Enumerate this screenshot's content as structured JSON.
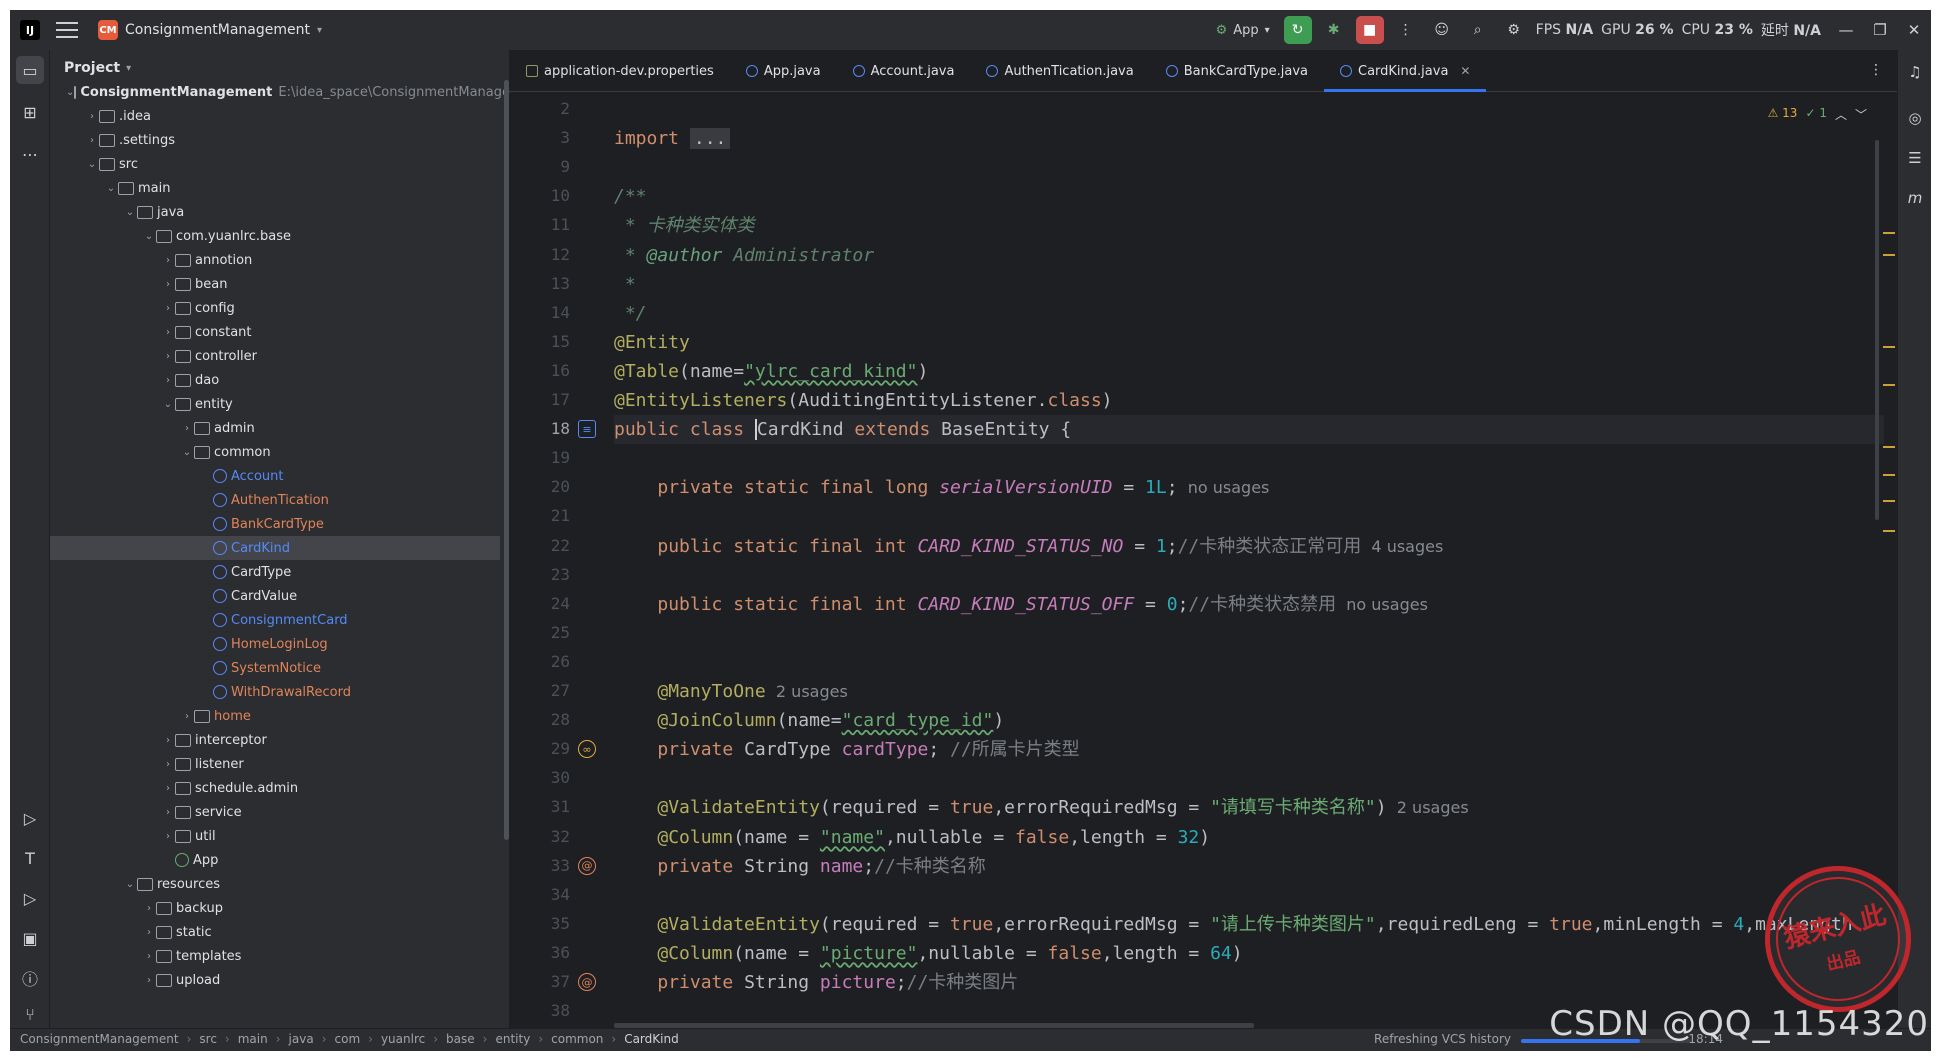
{
  "titlebar": {
    "project_badge": "CM",
    "project_name": "ConsignmentManagement",
    "run_config": "App",
    "stats": {
      "fps_label": "FPS",
      "fps_value": "N/A",
      "gpu_label": "GPU",
      "gpu_value": "26 %",
      "cpu_label": "CPU",
      "cpu_value": "23 %",
      "latency_label": "延时",
      "latency_value": "N/A"
    }
  },
  "project_panel": {
    "title": "Project",
    "tree": [
      {
        "label": "ConsignmentManagement",
        "path": "E:\\idea_space\\ConsignmentManagement",
        "depth": 0,
        "kind": "root",
        "open": true
      },
      {
        "label": ".idea",
        "depth": 1,
        "kind": "dir",
        "open": false
      },
      {
        "label": ".settings",
        "depth": 1,
        "kind": "dir",
        "open": false
      },
      {
        "label": "src",
        "depth": 1,
        "kind": "dir",
        "open": true
      },
      {
        "label": "main",
        "depth": 2,
        "kind": "dir",
        "open": true
      },
      {
        "label": "java",
        "depth": 3,
        "kind": "dir",
        "open": true
      },
      {
        "label": "com.yuanlrc.base",
        "depth": 4,
        "kind": "dir",
        "open": true
      },
      {
        "label": "annotion",
        "depth": 5,
        "kind": "dir",
        "open": false
      },
      {
        "label": "bean",
        "depth": 5,
        "kind": "dir",
        "open": false
      },
      {
        "label": "config",
        "depth": 5,
        "kind": "dir",
        "open": false
      },
      {
        "label": "constant",
        "depth": 5,
        "kind": "dir",
        "open": false
      },
      {
        "label": "controller",
        "depth": 5,
        "kind": "dir",
        "open": false
      },
      {
        "label": "dao",
        "depth": 5,
        "kind": "dir",
        "open": false
      },
      {
        "label": "entity",
        "depth": 5,
        "kind": "dir",
        "open": true
      },
      {
        "label": "admin",
        "depth": 6,
        "kind": "dir",
        "open": false
      },
      {
        "label": "common",
        "depth": 6,
        "kind": "dir",
        "open": true
      },
      {
        "label": "Account",
        "depth": 7,
        "kind": "cls"
      },
      {
        "label": "AuthenTication",
        "depth": 7,
        "kind": "err"
      },
      {
        "label": "BankCardType",
        "depth": 7,
        "kind": "err"
      },
      {
        "label": "CardKind",
        "depth": 7,
        "kind": "cls",
        "selected": true
      },
      {
        "label": "CardType",
        "depth": 7,
        "kind": "plain"
      },
      {
        "label": "CardValue",
        "depth": 7,
        "kind": "plain"
      },
      {
        "label": "ConsignmentCard",
        "depth": 7,
        "kind": "cls"
      },
      {
        "label": "HomeLoginLog",
        "depth": 7,
        "kind": "err"
      },
      {
        "label": "SystemNotice",
        "depth": 7,
        "kind": "err"
      },
      {
        "label": "WithDrawalRecord",
        "depth": 7,
        "kind": "err"
      },
      {
        "label": "home",
        "depth": 6,
        "kind": "direrr",
        "open": false
      },
      {
        "label": "interceptor",
        "depth": 5,
        "kind": "dir",
        "open": false
      },
      {
        "label": "listener",
        "depth": 5,
        "kind": "dir",
        "open": false
      },
      {
        "label": "schedule.admin",
        "depth": 5,
        "kind": "dir",
        "open": false
      },
      {
        "label": "service",
        "depth": 5,
        "kind": "dir",
        "open": false
      },
      {
        "label": "util",
        "depth": 5,
        "kind": "dir",
        "open": false
      },
      {
        "label": "App",
        "depth": 5,
        "kind": "app"
      },
      {
        "label": "resources",
        "depth": 3,
        "kind": "dir",
        "open": true
      },
      {
        "label": "backup",
        "depth": 4,
        "kind": "dir",
        "open": false
      },
      {
        "label": "static",
        "depth": 4,
        "kind": "dir",
        "open": false
      },
      {
        "label": "templates",
        "depth": 4,
        "kind": "dir",
        "open": false
      },
      {
        "label": "upload",
        "depth": 4,
        "kind": "dir",
        "open": false
      }
    ]
  },
  "tabs": [
    {
      "label": "application-dev.properties",
      "kind": "prop"
    },
    {
      "label": "App.java",
      "kind": "cls"
    },
    {
      "label": "Account.java",
      "kind": "cls"
    },
    {
      "label": "AuthenTication.java",
      "kind": "cls"
    },
    {
      "label": "BankCardType.java",
      "kind": "cls"
    },
    {
      "label": "CardKind.java",
      "kind": "cls",
      "active": true
    }
  ],
  "inspections": {
    "warnings": "13",
    "ok": "1"
  },
  "code": {
    "current_line": "18",
    "lines": [
      {
        "n": "2",
        "parts": []
      },
      {
        "n": "3",
        "parts": [
          [
            "kw",
            "import "
          ],
          [
            "fold",
            "..."
          ]
        ]
      },
      {
        "n": "9",
        "parts": []
      },
      {
        "n": "10",
        "parts": [
          [
            "doc",
            "/**"
          ]
        ]
      },
      {
        "n": "11",
        "parts": [
          [
            "doc",
            " * 卡种类实体类"
          ]
        ]
      },
      {
        "n": "12",
        "parts": [
          [
            "doc",
            " * "
          ],
          [
            "doctag",
            "@author"
          ],
          [
            "doc",
            " Administrator"
          ]
        ]
      },
      {
        "n": "13",
        "parts": [
          [
            "doc",
            " *"
          ]
        ]
      },
      {
        "n": "14",
        "parts": [
          [
            "doc",
            " */"
          ]
        ]
      },
      {
        "n": "15",
        "parts": [
          [
            "an",
            "@Entity"
          ]
        ]
      },
      {
        "n": "16",
        "parts": [
          [
            "an",
            "@Table"
          ],
          [
            "",
            "(name="
          ],
          [
            "str",
            "\"ylrc_card_kind\""
          ],
          [
            "",
            ")"
          ]
        ]
      },
      {
        "n": "17",
        "parts": [
          [
            "an",
            "@EntityListeners"
          ],
          [
            "",
            "(AuditingEntityListener."
          ],
          [
            "kw",
            "class"
          ],
          [
            "",
            ")"
          ]
        ]
      },
      {
        "n": "18",
        "parts": [
          [
            "kw",
            "public class "
          ],
          [
            "caret",
            "CardKind"
          ],
          [
            "kw",
            " extends "
          ],
          [
            "",
            "BaseEntity {"
          ]
        ],
        "gicon": "db"
      },
      {
        "n": "19",
        "parts": []
      },
      {
        "n": "20",
        "parts": [
          [
            "",
            "    "
          ],
          [
            "kw",
            "private static final long "
          ],
          [
            "sfld",
            "serialVersionUID"
          ],
          [
            "",
            " = "
          ],
          [
            "num",
            "1L"
          ],
          [
            "",
            ";"
          ],
          [
            "hint",
            "  no usages"
          ]
        ]
      },
      {
        "n": "21",
        "parts": []
      },
      {
        "n": "22",
        "parts": [
          [
            "",
            "    "
          ],
          [
            "kw",
            "public static final int "
          ],
          [
            "sfld",
            "CARD_KIND_STATUS_NO"
          ],
          [
            "",
            " = "
          ],
          [
            "num",
            "1"
          ],
          [
            "",
            ";"
          ],
          [
            "cm",
            "//卡种类状态正常可用"
          ],
          [
            "hint",
            "  4 usages"
          ]
        ]
      },
      {
        "n": "23",
        "parts": []
      },
      {
        "n": "24",
        "parts": [
          [
            "",
            "    "
          ],
          [
            "kw",
            "public static final int "
          ],
          [
            "sfld",
            "CARD_KIND_STATUS_OFF"
          ],
          [
            "",
            " = "
          ],
          [
            "num",
            "0"
          ],
          [
            "",
            ";"
          ],
          [
            "cm",
            "//卡种类状态禁用"
          ],
          [
            "hint",
            "  no usages"
          ]
        ]
      },
      {
        "n": "25",
        "parts": []
      },
      {
        "n": "26",
        "parts": []
      },
      {
        "n": "27",
        "parts": [
          [
            "",
            "    "
          ],
          [
            "an",
            "@ManyToOne"
          ],
          [
            "hint",
            "  2 usages"
          ]
        ]
      },
      {
        "n": "28",
        "parts": [
          [
            "",
            "    "
          ],
          [
            "an",
            "@JoinColumn"
          ],
          [
            "",
            "(name="
          ],
          [
            "str",
            "\"card_type_id\""
          ],
          [
            "",
            ")"
          ]
        ]
      },
      {
        "n": "29",
        "parts": [
          [
            "",
            "    "
          ],
          [
            "kw",
            "private "
          ],
          [
            "",
            "CardType "
          ],
          [
            "fld",
            "cardType"
          ],
          [
            "",
            "; "
          ],
          [
            "cm",
            "//所属卡片类型"
          ]
        ],
        "gicon": "link"
      },
      {
        "n": "30",
        "parts": []
      },
      {
        "n": "31",
        "parts": [
          [
            "",
            "    "
          ],
          [
            "an",
            "@ValidateEntity"
          ],
          [
            "",
            "(required = "
          ],
          [
            "kw",
            "true"
          ],
          [
            "",
            ",errorRequiredMsg = "
          ],
          [
            "str",
            "\"请填写卡种类名称\""
          ],
          [
            "",
            ")"
          ],
          [
            "hint",
            "  2 usages"
          ]
        ]
      },
      {
        "n": "32",
        "parts": [
          [
            "",
            "    "
          ],
          [
            "an",
            "@Column"
          ],
          [
            "",
            "(name = "
          ],
          [
            "str",
            "\"name\""
          ],
          [
            "",
            ",nullable = "
          ],
          [
            "kw",
            "false"
          ],
          [
            "",
            ",length = "
          ],
          [
            "num",
            "32"
          ],
          [
            "",
            ")"
          ]
        ]
      },
      {
        "n": "33",
        "parts": [
          [
            "",
            "    "
          ],
          [
            "kw",
            "private "
          ],
          [
            "",
            "String "
          ],
          [
            "fld",
            "name"
          ],
          [
            "",
            ";"
          ],
          [
            "cm",
            "//卡种类名称"
          ]
        ],
        "gicon": "at"
      },
      {
        "n": "34",
        "parts": []
      },
      {
        "n": "35",
        "parts": [
          [
            "",
            "    "
          ],
          [
            "an",
            "@ValidateEntity"
          ],
          [
            "",
            "(required = "
          ],
          [
            "kw",
            "true"
          ],
          [
            "",
            ",errorRequiredMsg = "
          ],
          [
            "str",
            "\"请上传卡种类图片\""
          ],
          [
            "",
            ",requiredLeng = "
          ],
          [
            "kw",
            "true"
          ],
          [
            "",
            ",minLength = "
          ],
          [
            "num",
            "4"
          ],
          [
            "",
            ",maxLength"
          ]
        ]
      },
      {
        "n": "36",
        "parts": [
          [
            "",
            "    "
          ],
          [
            "an",
            "@Column"
          ],
          [
            "",
            "(name = "
          ],
          [
            "str",
            "\"picture\""
          ],
          [
            "",
            ",nullable = "
          ],
          [
            "kw",
            "false"
          ],
          [
            "",
            ",length = "
          ],
          [
            "num",
            "64"
          ],
          [
            "",
            ")"
          ]
        ]
      },
      {
        "n": "37",
        "parts": [
          [
            "",
            "    "
          ],
          [
            "kw",
            "private "
          ],
          [
            "",
            "String "
          ],
          [
            "fld",
            "picture"
          ],
          [
            "",
            ";"
          ],
          [
            "cm",
            "//卡种类图片"
          ]
        ],
        "gicon": "at"
      },
      {
        "n": "38",
        "parts": []
      }
    ]
  },
  "statusbar": {
    "breadcrumbs": [
      "ConsignmentManagement",
      "src",
      "main",
      "java",
      "com",
      "yuanlrc",
      "base",
      "entity",
      "common",
      "CardKind"
    ],
    "task": "Refreshing VCS history",
    "task_progress": 0.7,
    "time": "18:14"
  },
  "watermark": {
    "csdn": "CSDN @QQ_1154320",
    "stamp_line1": "猿来入此",
    "stamp_line2": "出品"
  },
  "colors": {
    "accent": "#3574f0",
    "keyword": "#cf8e6d",
    "annotation": "#b3ae60",
    "string": "#6aab73",
    "number": "#2aacb8",
    "field": "#c77dbb"
  }
}
